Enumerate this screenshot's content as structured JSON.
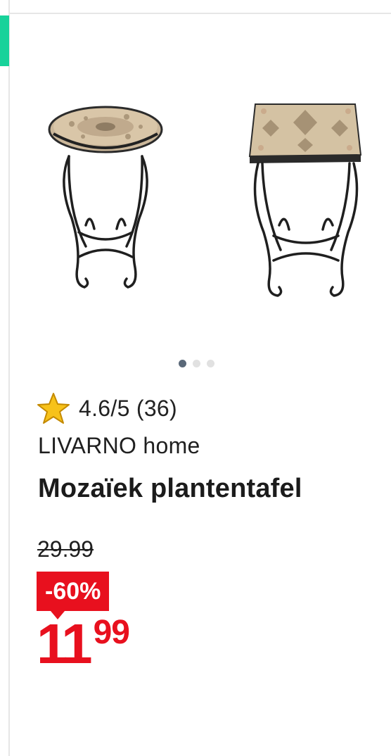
{
  "gallery": {
    "images": [
      "round-mosaic-table",
      "square-mosaic-table"
    ],
    "active_index": 0,
    "total": 3
  },
  "rating": {
    "text": "4.6/5 (36)",
    "score": 4.6,
    "max": 5,
    "count": 36
  },
  "product": {
    "brand": "LIVARNO home",
    "title": "Mozaïek plantentafel"
  },
  "pricing": {
    "old_price": "29.99",
    "discount": "-60%",
    "price_int": "11",
    "price_dec": "99"
  },
  "colors": {
    "accent": "#18d29a",
    "sale": "#e8101e",
    "star": "#f7c21a"
  }
}
